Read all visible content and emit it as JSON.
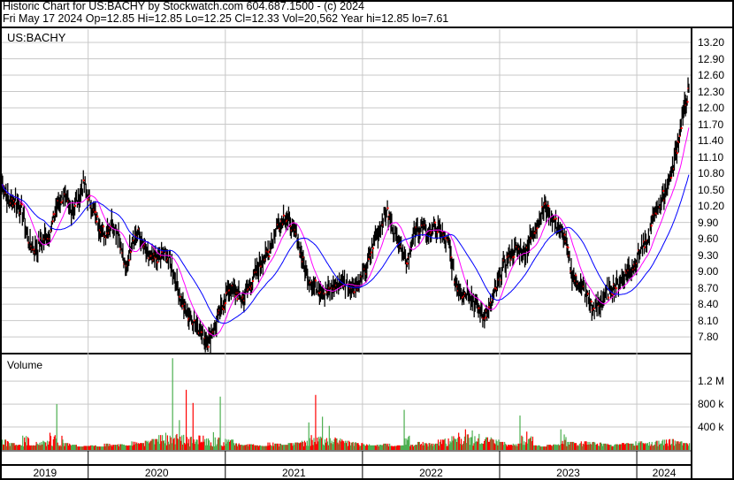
{
  "header": {
    "title": "Historic Chart for US:BACHY by Stockwatch.com 604.687.1500 - (c) 2024",
    "quote": "Fri May 17 2024  Op=12.85  Hi=12.85  Lo=12.25  Cl=12.33  Vol=20,562  Year hi=12.85  lo=7.61"
  },
  "chart_data": {
    "type": "candlestick",
    "symbol": "US:BACHY",
    "x_start_year": 2019.37,
    "x_end_year": 2024.38,
    "year_ticks": [
      "2019",
      "2020",
      "2021",
      "2022",
      "2023",
      "2024"
    ],
    "year_starts": [
      2019,
      2020,
      2021,
      2022,
      2023,
      2024
    ],
    "ylim": [
      7.6,
      13.35
    ],
    "y_ticks": [
      "13.20",
      "12.90",
      "12.60",
      "12.30",
      "12.00",
      "11.70",
      "11.40",
      "11.10",
      "10.80",
      "10.50",
      "10.20",
      "9.90",
      "9.60",
      "9.30",
      "9.00",
      "8.70",
      "8.40",
      "8.10",
      "7.80"
    ],
    "closes": [
      10.6,
      10.3,
      10.3,
      10.1,
      9.5,
      9.4,
      9.6,
      9.7,
      10.2,
      10.4,
      10.1,
      10.3,
      10.6,
      10.2,
      9.9,
      9.7,
      9.9,
      9.7,
      9.0,
      9.6,
      9.7,
      9.3,
      9.2,
      9.3,
      9.3,
      9.0,
      8.5,
      8.2,
      8.1,
      7.9,
      7.7,
      8.0,
      8.3,
      8.7,
      8.6,
      8.5,
      8.7,
      9.0,
      9.2,
      9.4,
      9.8,
      10.0,
      9.9,
      9.6,
      9.1,
      8.8,
      8.7,
      8.6,
      8.7,
      8.8,
      8.8,
      8.7,
      8.8,
      9.0,
      9.5,
      9.8,
      10.1,
      9.8,
      9.5,
      9.2,
      9.7,
      9.8,
      9.7,
      9.8,
      9.7,
      9.5,
      8.8,
      8.6,
      8.6,
      8.4,
      8.2,
      8.3,
      8.7,
      9.1,
      9.3,
      9.4,
      9.3,
      9.6,
      9.9,
      10.2,
      10.0,
      9.8,
      9.6,
      8.9,
      8.8,
      8.6,
      8.3,
      8.4,
      8.6,
      8.7,
      8.8,
      9.0,
      9.1,
      9.4,
      9.5,
      10.1,
      10.3,
      10.6,
      11.1,
      11.8,
      12.33
    ],
    "ma_short_color": "#ff00ff",
    "ma_long_color": "#0000ff",
    "volume": {
      "label": "Volume",
      "y_ticks": [
        "1.2 M",
        "800 k",
        "400 k"
      ],
      "y_tick_values": [
        1200,
        800,
        400
      ],
      "ylim": [
        0,
        1650
      ],
      "unit": "k",
      "up_color": "#4caf50",
      "down_color": "#ff0000",
      "values": [
        180,
        120,
        90,
        250,
        80,
        140,
        160,
        300,
        800,
        120,
        90,
        60,
        70,
        80,
        60,
        110,
        90,
        100,
        80,
        150,
        120,
        160,
        190,
        260,
        300,
        1600,
        520,
        1050,
        820,
        250,
        200,
        310,
        930,
        180,
        120,
        90,
        100,
        80,
        70,
        130,
        110,
        90,
        120,
        130,
        160,
        480,
        960,
        580,
        420,
        200,
        160,
        140,
        120,
        100,
        80,
        90,
        110,
        70,
        80,
        700,
        90,
        140,
        120,
        110,
        180,
        200,
        240,
        300,
        360,
        340,
        280,
        220,
        180,
        140,
        90,
        110,
        600,
        320,
        80,
        60,
        90,
        100,
        360,
        140,
        120,
        150,
        140,
        130,
        110,
        90,
        100,
        120,
        110,
        150,
        120,
        140,
        160,
        180,
        190,
        150,
        120
      ]
    }
  }
}
